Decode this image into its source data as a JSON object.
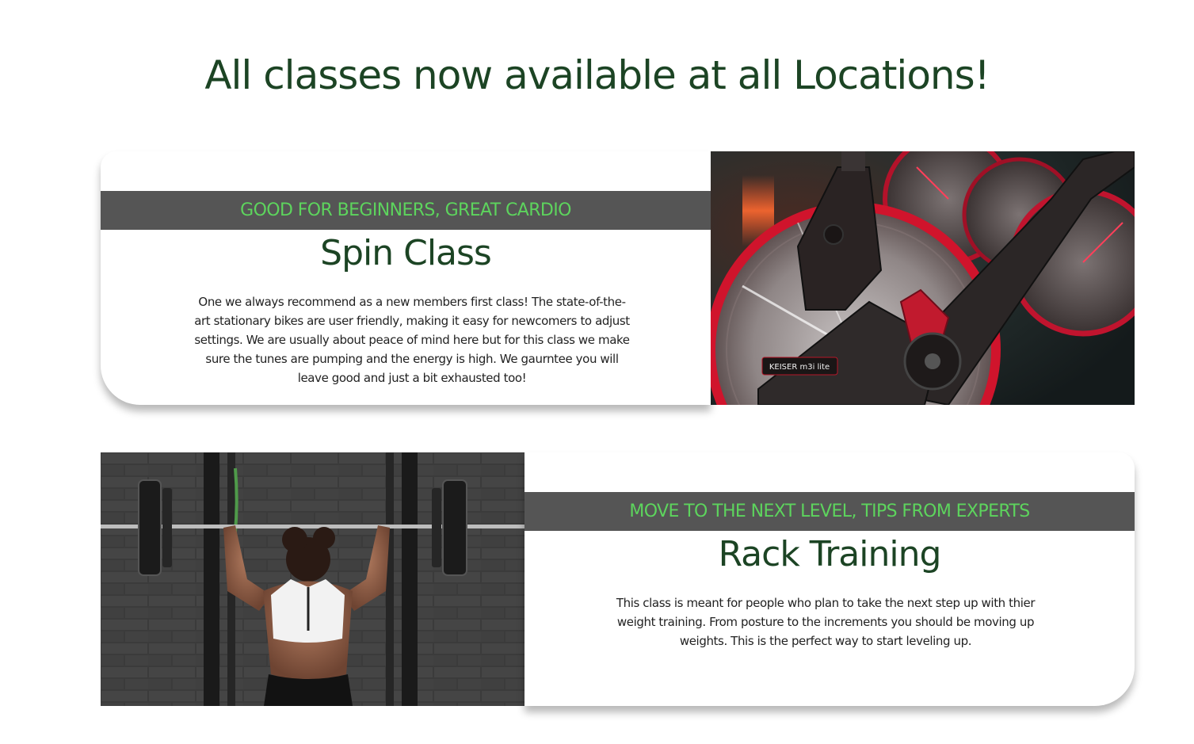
{
  "page": {
    "title": "All classes now available at all Locations!"
  },
  "classes": [
    {
      "tagline": "GOOD FOR BEGINNERS, GREAT CARDIO",
      "name": "Spin Class",
      "description": "One we always recommend as a new members first class! The state-of-the-art stationary bikes are user friendly, making it easy for newcomers to adjust settings. We are usually about peace of mind here but for this class we make sure the tunes are pumping and the energy is high. We gaurntee you will leave good and just a bit exhausted too!",
      "image_label": "KEISER m3i lite"
    },
    {
      "tagline": "MOVE TO THE NEXT LEVEL, TIPS FROM EXPERTS",
      "name": "Rack Training",
      "description": "This class is meant for people who plan to take the next step up with thier weight training. From posture to the increments you should be moving up weights. This is the perfect way to start leveling up."
    }
  ],
  "colors": {
    "heading": "#1c4424",
    "tagline_text": "#5dd45d",
    "tagline_bar": "#555555",
    "body_text": "#222222"
  }
}
